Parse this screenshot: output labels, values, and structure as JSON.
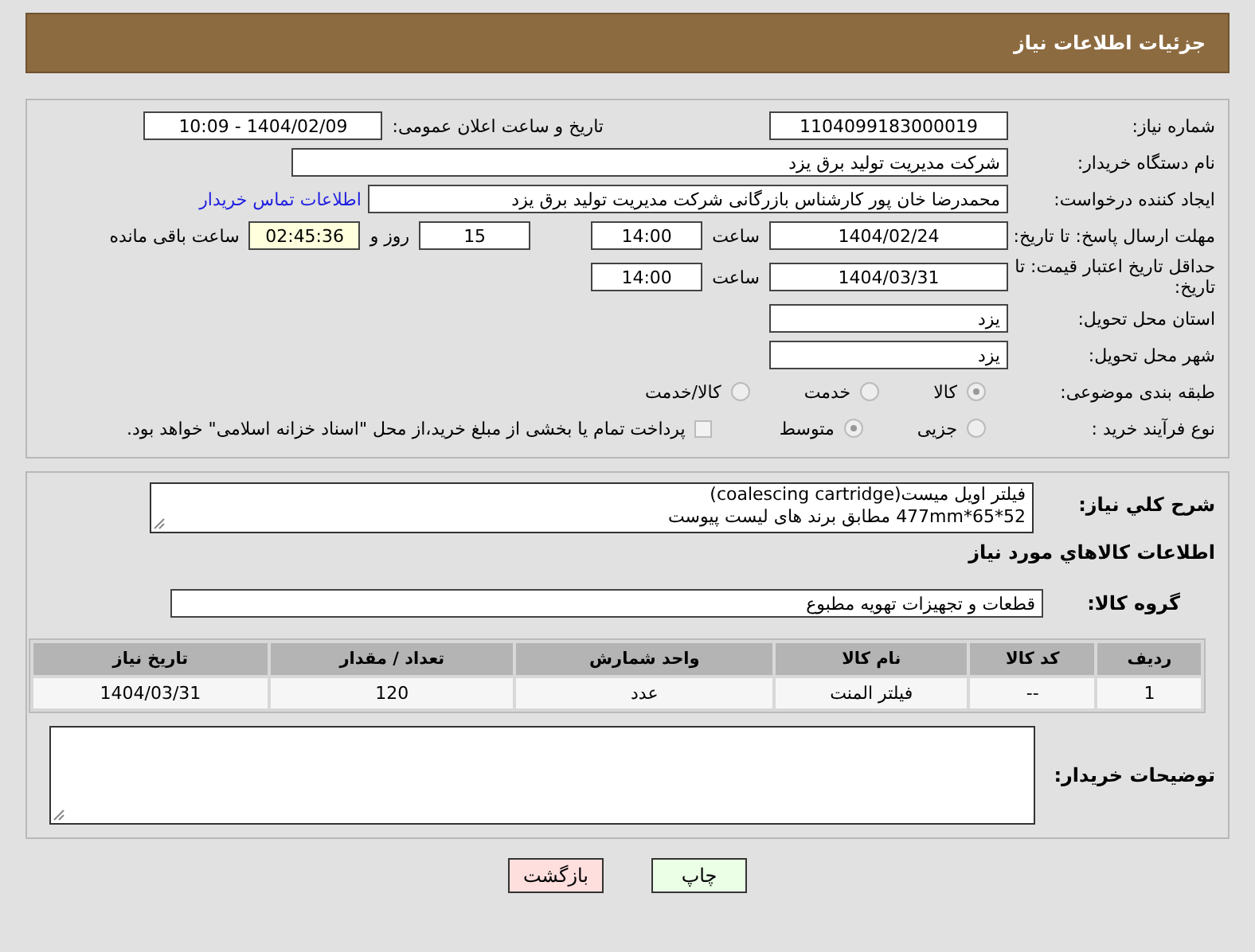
{
  "header": {
    "title": "جزئیات اطلاعات نیاز"
  },
  "need_number": {
    "label": "شماره نیاز:",
    "value": "1104099183000019"
  },
  "announce": {
    "label": "تاریخ و ساعت اعلان عمومی:",
    "value": "1404/02/09 - 10:09"
  },
  "buyer_org": {
    "label": "نام دستگاه خریدار:",
    "value": "شرکت مدیریت تولید برق یزد"
  },
  "requester": {
    "label": "ایجاد کننده درخواست:",
    "value": "محمدرضا خان پور کارشناس بازرگانی شرکت مدیریت تولید برق یزد",
    "link": "اطلاعات تماس خریدار"
  },
  "deadline": {
    "label": "مهلت ارسال پاسخ: تا تاریخ:",
    "date": "1404/02/24",
    "time_label": "ساعت",
    "time": "14:00",
    "days": "15",
    "days_label": "روز و",
    "remaining": "02:45:36",
    "remaining_label": "ساعت باقی مانده"
  },
  "validity": {
    "label": "حداقل تاریخ اعتبار قیمت: تا تاریخ:",
    "date": "1404/03/31",
    "time_label": "ساعت",
    "time": "14:00"
  },
  "province": {
    "label": "استان محل تحویل:",
    "value": "یزد"
  },
  "city": {
    "label": "شهر محل تحویل:",
    "value": "یزد"
  },
  "category": {
    "label": "طبقه بندی موضوعی:",
    "options": [
      {
        "label": "کالا",
        "selected": true
      },
      {
        "label": "خدمت",
        "selected": false
      },
      {
        "label": "کالا/خدمت",
        "selected": false
      }
    ]
  },
  "process": {
    "label": "نوع فرآیند خرید :",
    "options": [
      {
        "label": "جزیی",
        "selected": false
      },
      {
        "label": "متوسط",
        "selected": true
      }
    ],
    "payment": {
      "label": "پرداخت تمام یا بخشی از مبلغ خرید،از محل \"اسناد خزانه اسلامی\" خواهد بود.",
      "checked": false
    }
  },
  "description": {
    "label": "شرح کلي نياز:",
    "lines": [
      "فیلتر اویل میست(coalescing cartridge)",
      "52*65*477mm   مطابق برند های لیست پیوست"
    ]
  },
  "items_title": "اطلاعات کالاهاي مورد نياز",
  "goods_group": {
    "label": "گروه کالا:",
    "value": "قطعات و تجهیزات تهویه مطبوع"
  },
  "table": {
    "columns": [
      "ردیف",
      "کد کالا",
      "نام کالا",
      "واحد شمارش",
      "تعداد / مقدار",
      "تاریخ نیاز"
    ],
    "rows": [
      [
        "1",
        "--",
        "فیلتر المنت",
        "عدد",
        "120",
        "1404/03/31"
      ]
    ]
  },
  "buyer_notes": {
    "label": "توضیحات خریدار:"
  },
  "buttons": [
    {
      "label": "چاپ",
      "kind": "print"
    },
    {
      "label": "بازگشت",
      "kind": "back"
    }
  ]
}
